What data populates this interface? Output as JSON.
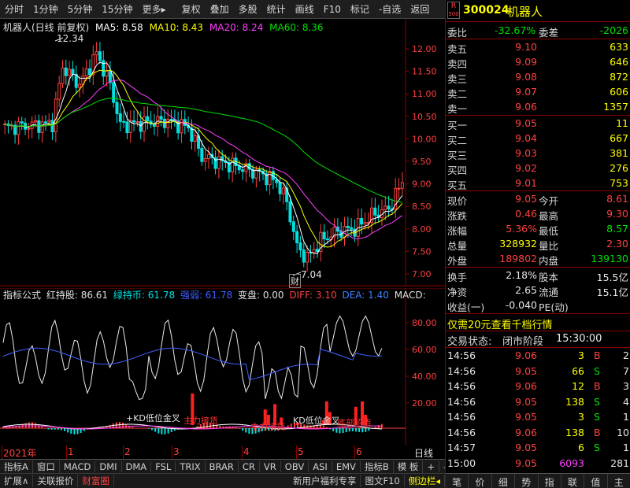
{
  "toolbar": {
    "items": [
      "分时",
      "1分钟",
      "5分钟",
      "15分钟",
      "更多▸",
      "复权",
      "叠加",
      "多股",
      "统计",
      "画线",
      "F10",
      "标记",
      "-自选",
      "返回"
    ]
  },
  "main_chart": {
    "title": "机器人(日线 前复权)",
    "ma5": "MA5: 8.58",
    "ma10": "MA10: 8.43",
    "ma20": "MA20: 8.24",
    "ma60": "MA60: 8.36",
    "high_label": "12.34",
    "low_label": "7.04",
    "low_tag": "财",
    "y_ticks": [
      "12.00",
      "11.50",
      "11.00",
      "10.50",
      "10.00",
      "9.50",
      "9.00",
      "8.50",
      "8.00",
      "7.50",
      "7.00"
    ],
    "colors": {
      "up": "#ff4040",
      "down": "#00e0e0",
      "ma5": "#ffffff",
      "ma10": "#ffff00",
      "ma20": "#ff40ff",
      "ma60": "#00e000"
    }
  },
  "indicator": {
    "name": "指标公式",
    "hongzhuchi": "红持股: 86.61",
    "lvchishi": "绿持币: 61.78",
    "qiangruo": "强弱: 61.78",
    "bianpan": "变盘: 0.00",
    "diff": "DIFF: 3.10",
    "dea": "DEA: 1.40",
    "macd": "MACD:",
    "y_ticks": [
      "80.00",
      "60.00",
      "40.00",
      "20.00"
    ],
    "annotations": [
      "+KD低位金叉",
      "KD低位金叉",
      "主力接货",
      "主力接货",
      "底部招点"
    ]
  },
  "time_axis": {
    "labels": [
      "2021年",
      "1",
      "2",
      "3",
      "4",
      "5",
      "6"
    ],
    "period": "日线"
  },
  "tabs_row1": [
    "指标A",
    "窗口",
    "MACD",
    "DMI",
    "DMA",
    "FSL",
    "TRIX",
    "BRAR",
    "CR",
    "VR",
    "OBV",
    "ASI",
    "EMV",
    "指标B",
    "模 板",
    "+",
    "-"
  ],
  "tabs_row2": [
    "扩展∧",
    "关联报价",
    "财富圈",
    "新用户福利专享",
    "图文F10",
    "侧边栏◂"
  ],
  "quote": {
    "badge_top": "R",
    "badge_bottom": "500",
    "code": "300024",
    "name": "机器人",
    "weibi_label": "委比",
    "weibi": "-32.67%",
    "weicha_label": "委差",
    "weicha": "-2026",
    "sell": [
      {
        "label": "卖五",
        "price": "9.10",
        "vol": "633"
      },
      {
        "label": "卖四",
        "price": "9.09",
        "vol": "646"
      },
      {
        "label": "卖三",
        "price": "9.08",
        "vol": "872"
      },
      {
        "label": "卖二",
        "price": "9.07",
        "vol": "606"
      },
      {
        "label": "卖一",
        "price": "9.06",
        "vol": "1357"
      }
    ],
    "buy": [
      {
        "label": "买一",
        "price": "9.05",
        "vol": "11"
      },
      {
        "label": "买二",
        "price": "9.04",
        "vol": "667"
      },
      {
        "label": "买三",
        "price": "9.03",
        "vol": "381"
      },
      {
        "label": "买四",
        "price": "9.02",
        "vol": "276"
      },
      {
        "label": "买五",
        "price": "9.01",
        "vol": "753"
      }
    ],
    "stats": [
      {
        "l1": "现价",
        "v1": "9.05",
        "l2": "今开",
        "v2": "8.61"
      },
      {
        "l1": "涨跌",
        "v1": "0.46",
        "l2": "最高",
        "v2": "9.30"
      },
      {
        "l1": "涨幅",
        "v1": "5.36%",
        "l2": "最低",
        "v2": "8.57"
      },
      {
        "l1": "总量",
        "v1": "328932",
        "l2": "量比",
        "v2": "2.30"
      },
      {
        "l1": "外盘",
        "v1": "189802",
        "l2": "内盘",
        "v2": "139130"
      }
    ],
    "fund": [
      {
        "l1": "换手",
        "v1": "2.18%",
        "l2": "股本",
        "v2": "15.5亿"
      },
      {
        "l1": "净资",
        "v1": "2.65",
        "l2": "流通",
        "v2": "15.1亿"
      },
      {
        "l1": "收益(一)",
        "v1": "-0.040",
        "l2": "PE(动)",
        "v2": ""
      }
    ],
    "promo": "仅需20元查看千档行情",
    "status_label": "交易状态:",
    "status": "闭市阶段",
    "status_time": "15:30:00",
    "ticks": [
      {
        "time": "14:56",
        "price": "9.06",
        "vol": "3",
        "bs": "B",
        "n": "2"
      },
      {
        "time": "14:56",
        "price": "9.05",
        "vol": "66",
        "bs": "S",
        "n": "7"
      },
      {
        "time": "14:56",
        "price": "9.06",
        "vol": "12",
        "bs": "B",
        "n": "3"
      },
      {
        "time": "14:56",
        "price": "9.05",
        "vol": "138",
        "bs": "S",
        "n": "4"
      },
      {
        "time": "14:56",
        "price": "9.05",
        "vol": "3",
        "bs": "S",
        "n": "1"
      },
      {
        "time": "14:56",
        "price": "9.06",
        "vol": "138",
        "bs": "B",
        "n": "10"
      },
      {
        "time": "14:57",
        "price": "9.05",
        "vol": "6",
        "bs": "S",
        "n": "1"
      },
      {
        "time": "15:00",
        "price": "9.05",
        "vol": "6093",
        "bs": "",
        "n": "281"
      }
    ],
    "bottom_tabs": [
      "笔",
      "价",
      "细",
      "势",
      "指",
      "联",
      "值",
      "主"
    ]
  }
}
